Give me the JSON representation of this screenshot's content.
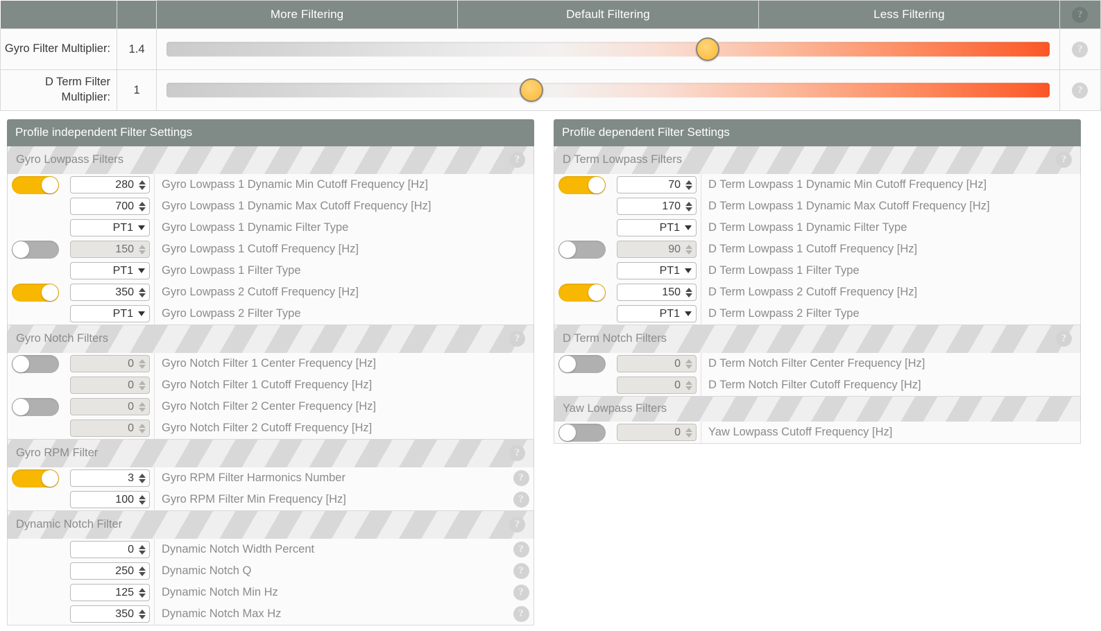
{
  "slider_header": {
    "columns": [
      "More Filtering",
      "Default Filtering",
      "Less Filtering"
    ],
    "help_label": "?"
  },
  "sliders": [
    {
      "name": "Gyro Filter Multiplier:",
      "value": "1.4",
      "position_pct": 61.0,
      "help_label": "?"
    },
    {
      "name": "D Term Filter Multiplier:",
      "value": "1",
      "position_pct": 41.5,
      "help_label": "?"
    }
  ],
  "panels": [
    {
      "title": "Profile independent Filter Settings",
      "sections": [
        {
          "name": "Gyro Lowpass Filters",
          "help_label": "?",
          "rows": [
            {
              "toggle": "on",
              "control": "number",
              "value": "280",
              "label": "Gyro Lowpass 1 Dynamic Min Cutoff Frequency [Hz]",
              "disabled": false
            },
            {
              "toggle": null,
              "control": "number",
              "value": "700",
              "label": "Gyro Lowpass 1 Dynamic Max Cutoff Frequency [Hz]",
              "disabled": false
            },
            {
              "toggle": null,
              "control": "select",
              "value": "PT1",
              "label": "Gyro Lowpass 1 Dynamic Filter Type",
              "disabled": false
            },
            {
              "toggle": "off",
              "control": "number",
              "value": "150",
              "label": "Gyro Lowpass 1 Cutoff Frequency [Hz]",
              "disabled": true
            },
            {
              "toggle": null,
              "control": "select",
              "value": "PT1",
              "label": "Gyro Lowpass 1 Filter Type",
              "disabled": false
            },
            {
              "toggle": "on",
              "control": "number",
              "value": "350",
              "label": "Gyro Lowpass 2 Cutoff Frequency [Hz]",
              "disabled": false
            },
            {
              "toggle": null,
              "control": "select",
              "value": "PT1",
              "label": "Gyro Lowpass 2 Filter Type",
              "disabled": false
            }
          ]
        },
        {
          "name": "Gyro Notch Filters",
          "help_label": "?",
          "rows": [
            {
              "toggle": "off",
              "control": "number",
              "value": "0",
              "label": "Gyro Notch Filter 1 Center Frequency [Hz]",
              "disabled": true
            },
            {
              "toggle": null,
              "control": "number",
              "value": "0",
              "label": "Gyro Notch Filter 1 Cutoff Frequency [Hz]",
              "disabled": true
            },
            {
              "toggle": "off",
              "control": "number",
              "value": "0",
              "label": "Gyro Notch Filter 2 Center Frequency [Hz]",
              "disabled": true
            },
            {
              "toggle": null,
              "control": "number",
              "value": "0",
              "label": "Gyro Notch Filter 2 Cutoff Frequency [Hz]",
              "disabled": true
            }
          ]
        },
        {
          "name": "Gyro RPM Filter",
          "help_label": "?",
          "rows": [
            {
              "toggle": "on",
              "control": "number",
              "value": "3",
              "label": "Gyro RPM Filter Harmonics Number",
              "disabled": false,
              "row_help": "?"
            },
            {
              "toggle": null,
              "control": "number",
              "value": "100",
              "label": "Gyro RPM Filter Min Frequency [Hz]",
              "disabled": false,
              "row_help": "?"
            }
          ]
        },
        {
          "name": "Dynamic Notch Filter",
          "help_label": "?",
          "rows": [
            {
              "toggle": null,
              "control": "number",
              "value": "0",
              "label": "Dynamic Notch Width Percent",
              "disabled": false,
              "row_help": "?"
            },
            {
              "toggle": null,
              "control": "number",
              "value": "250",
              "label": "Dynamic Notch Q",
              "disabled": false,
              "row_help": "?"
            },
            {
              "toggle": null,
              "control": "number",
              "value": "125",
              "label": "Dynamic Notch Min Hz",
              "disabled": false,
              "row_help": "?"
            },
            {
              "toggle": null,
              "control": "number",
              "value": "350",
              "label": "Dynamic Notch Max Hz",
              "disabled": false,
              "row_help": "?"
            }
          ]
        }
      ]
    },
    {
      "title": "Profile dependent Filter Settings",
      "sections": [
        {
          "name": "D Term Lowpass Filters",
          "help_label": "?",
          "rows": [
            {
              "toggle": "on",
              "control": "number",
              "value": "70",
              "label": "D Term Lowpass 1 Dynamic Min Cutoff Frequency [Hz]",
              "disabled": false
            },
            {
              "toggle": null,
              "control": "number",
              "value": "170",
              "label": "D Term Lowpass 1 Dynamic Max Cutoff Frequency [Hz]",
              "disabled": false
            },
            {
              "toggle": null,
              "control": "select",
              "value": "PT1",
              "label": "D Term Lowpass 1 Dynamic Filter Type",
              "disabled": false
            },
            {
              "toggle": "off",
              "control": "number",
              "value": "90",
              "label": "D Term Lowpass 1 Cutoff Frequency [Hz]",
              "disabled": true
            },
            {
              "toggle": null,
              "control": "select",
              "value": "PT1",
              "label": "D Term Lowpass 1 Filter Type",
              "disabled": false
            },
            {
              "toggle": "on",
              "control": "number",
              "value": "150",
              "label": "D Term Lowpass 2 Cutoff Frequency [Hz]",
              "disabled": false
            },
            {
              "toggle": null,
              "control": "select",
              "value": "PT1",
              "label": "D Term Lowpass 2 Filter Type",
              "disabled": false
            }
          ]
        },
        {
          "name": "D Term Notch Filters",
          "help_label": "?",
          "rows": [
            {
              "toggle": "off",
              "control": "number",
              "value": "0",
              "label": "D Term Notch Filter Center Frequency [Hz]",
              "disabled": true
            },
            {
              "toggle": null,
              "control": "number",
              "value": "0",
              "label": "D Term Notch Filter Cutoff Frequency [Hz]",
              "disabled": true
            }
          ]
        },
        {
          "name": "Yaw Lowpass Filters",
          "help_label": null,
          "rows": [
            {
              "toggle": "off",
              "control": "number",
              "value": "0",
              "label": "Yaw Lowpass Cutoff Frequency [Hz]",
              "disabled": true
            }
          ]
        }
      ]
    }
  ],
  "colors": {
    "accent_orange": "#f8b700",
    "slider_hot": "#fb5526",
    "header_gray": "#808b87",
    "thumb_gold": "#fdc44f"
  }
}
